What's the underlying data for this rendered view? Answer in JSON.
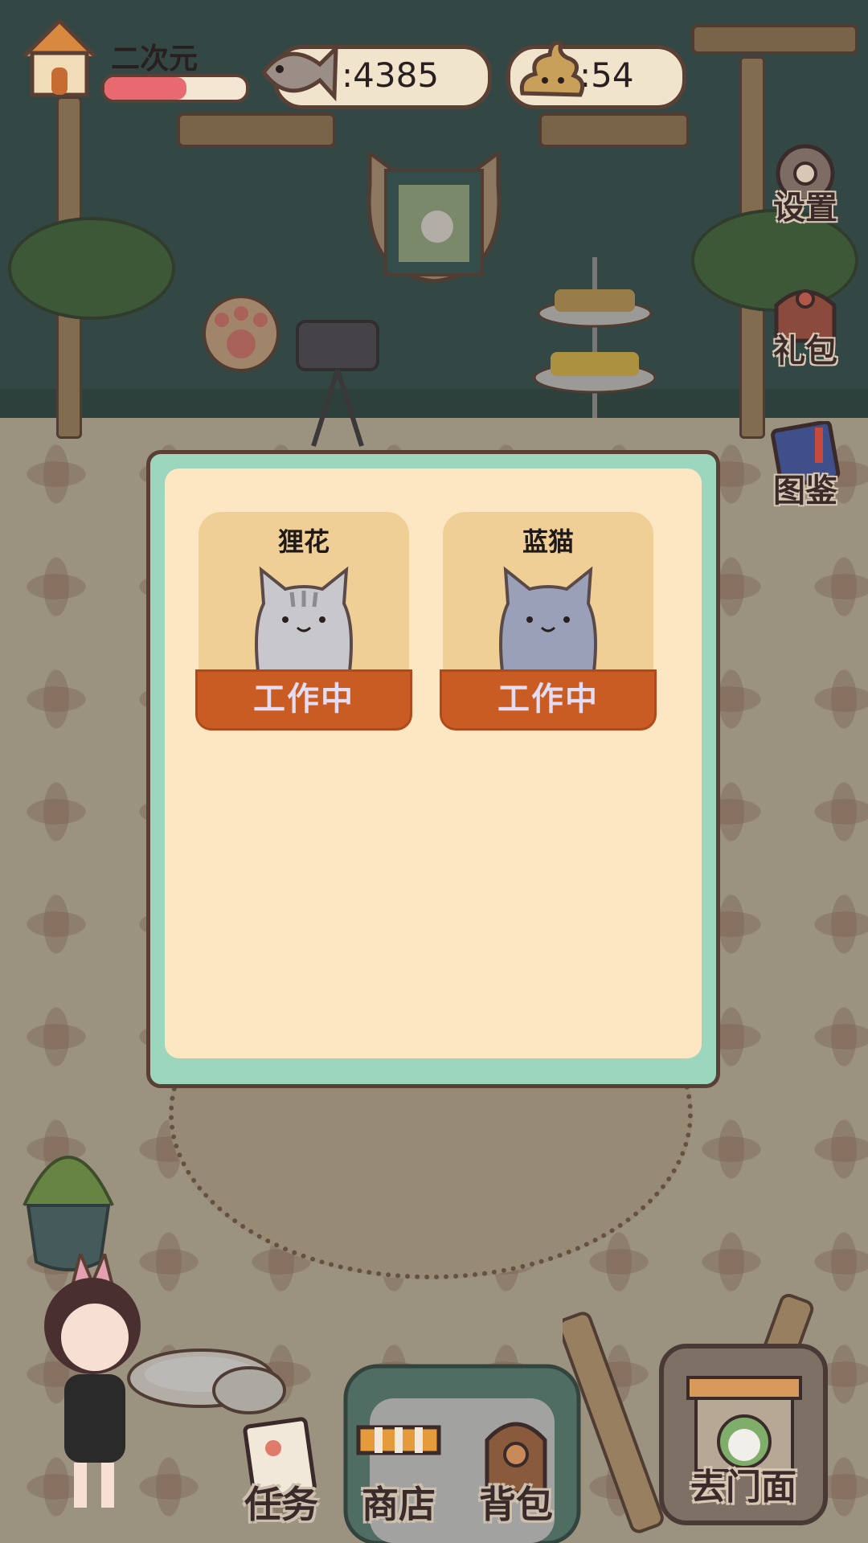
{
  "player": {
    "name": "二次元",
    "level_progress": 0.58
  },
  "currency": {
    "fish": "4385",
    "poop": "54",
    "fish_prefix": ":",
    "poop_prefix": ":"
  },
  "side_menu": [
    {
      "label": "设置",
      "icon": "gear-icon"
    },
    {
      "label": "礼包",
      "icon": "gift-bag-icon"
    },
    {
      "label": "图鉴",
      "icon": "book-icon"
    }
  ],
  "dialog": {
    "cats": [
      {
        "name": "狸花",
        "status": "工作中",
        "color": "#c8c8cc"
      },
      {
        "name": "蓝猫",
        "status": "工作中",
        "color": "#9aa0b8"
      }
    ]
  },
  "bottom_menu": [
    {
      "label": "任务",
      "icon": "task-paper-icon"
    },
    {
      "label": "商店",
      "icon": "shop-stall-icon"
    },
    {
      "label": "背包",
      "icon": "backpack-icon"
    }
  ],
  "go_shop": {
    "label": "去门面",
    "icon": "storefront-icon"
  },
  "colors": {
    "accent": "#c95c23",
    "dialog_frame": "#9cd6bd",
    "dialog_bg": "#fde7c3",
    "card_bg": "#f0cf97",
    "bar_fill": "#e86a70"
  }
}
